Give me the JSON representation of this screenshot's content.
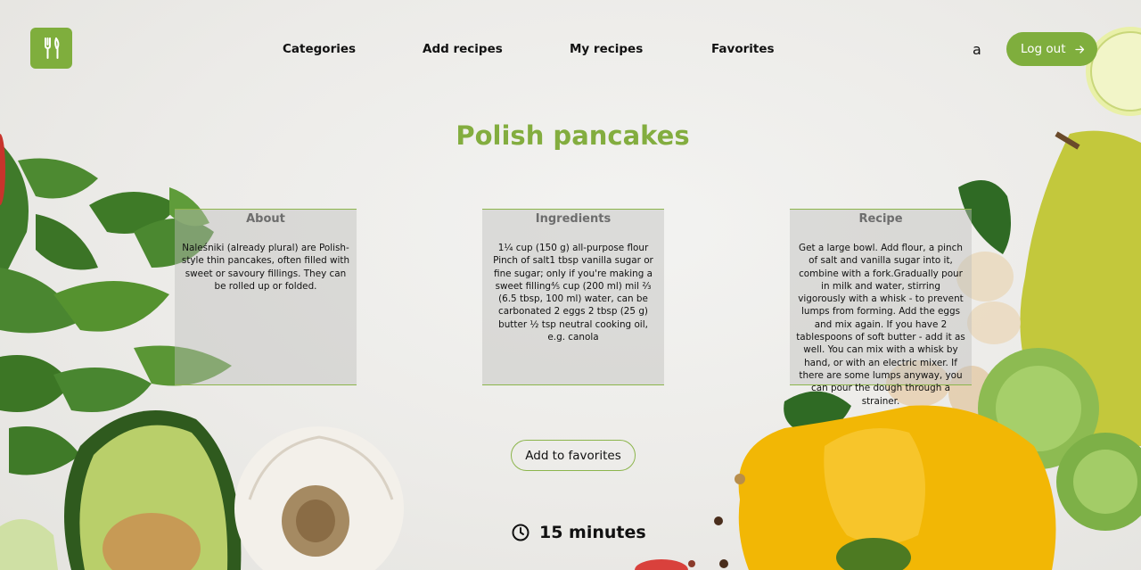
{
  "header": {
    "logo_icon": "fork-spoon-icon",
    "nav": [
      {
        "label": "Categories"
      },
      {
        "label": "Add recipes"
      },
      {
        "label": "My recipes"
      },
      {
        "label": "Favorites"
      }
    ],
    "user_initial": "a",
    "logout_label": "Log out",
    "logout_icon": "arrow-right-icon"
  },
  "recipe": {
    "title": "Polish pancakes",
    "cards": [
      {
        "title": "About",
        "text": "Naleśniki (already plural) are Polish-style thin pancakes, often filled with sweet or savoury fillings. They can be rolled up or folded."
      },
      {
        "title": "Ingredients",
        "text": "1¼ cup (150 g) all-purpose flour Pinch of salt1 tbsp vanilla sugar or fine sugar; only if you're making a sweet filling⅘ cup (200 ml) mil ⅔ (6.5 tbsp, 100 ml) water, can be carbonated 2 eggs 2 tbsp (25 g) butter ½ tsp neutral cooking oil, e.g. canola"
      },
      {
        "title": "Recipe",
        "text": "Get a large bowl. Add flour, a pinch of salt and vanilla sugar into it, combine with a fork.Gradually pour in milk and water, stirring vigorously with a whisk - to prevent lumps from forming. Add the eggs and mix again. If you have 2 tablespoons of soft butter - add it as well. You can mix with a whisk by hand, or with an electric mixer. If there are some lumps anyway, you can pour the dough through a strainer."
      }
    ],
    "favorite_label": "Add to favorites",
    "time_icon": "clock-icon",
    "time": "15 minutes"
  },
  "colors": {
    "accent": "#7fae3d",
    "title": "#83ad3f"
  }
}
